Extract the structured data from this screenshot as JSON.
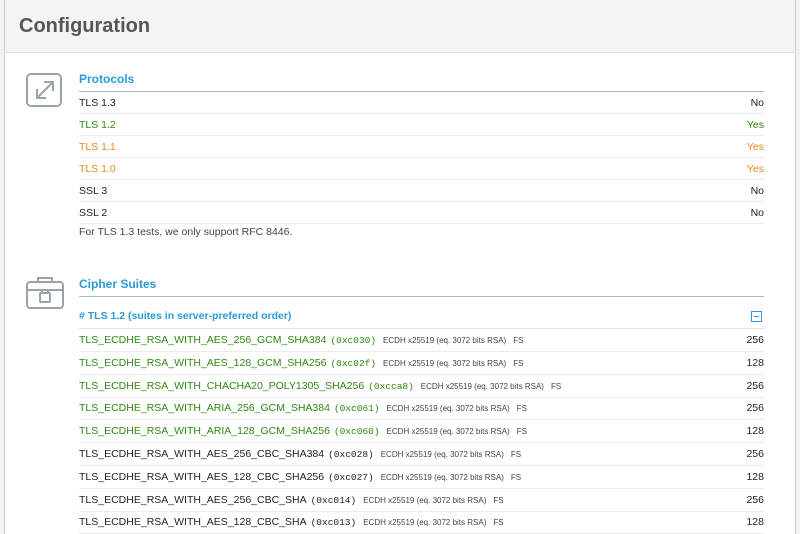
{
  "header": {
    "title": "Configuration"
  },
  "protocols": {
    "title": "Protocols",
    "icon": "resize-arrows-icon",
    "rows": [
      {
        "name": "TLS 1.3",
        "value": "No",
        "status": "neutral"
      },
      {
        "name": "TLS 1.2",
        "value": "Yes",
        "status": "good"
      },
      {
        "name": "TLS 1.1",
        "value": "Yes",
        "status": "warn"
      },
      {
        "name": "TLS 1.0",
        "value": "Yes",
        "status": "warn"
      },
      {
        "name": "SSL 3",
        "value": "No",
        "status": "neutral"
      },
      {
        "name": "SSL 2",
        "value": "No",
        "status": "neutral"
      }
    ],
    "note": "For TLS 1.3 tests, we only support RFC 8446."
  },
  "cipher_suites": {
    "title": "Cipher Suites",
    "icon": "lockbox-icon",
    "group_title": "# TLS 1.2 (suites in server-preferred order)",
    "rows": [
      {
        "name": "TLS_ECDHE_RSA_WITH_AES_256_GCM_SHA384",
        "hex": "(0xc030)",
        "kx": "ECDH x25519 (eq. 3072 bits RSA)",
        "fs": "FS",
        "bits": "256",
        "strong": true
      },
      {
        "name": "TLS_ECDHE_RSA_WITH_AES_128_GCM_SHA256",
        "hex": "(0xc02f)",
        "kx": "ECDH x25519 (eq. 3072 bits RSA)",
        "fs": "FS",
        "bits": "128",
        "strong": true
      },
      {
        "name": "TLS_ECDHE_RSA_WITH_CHACHA20_POLY1305_SHA256",
        "hex": "(0xcca8)",
        "kx": "ECDH x25519 (eq. 3072 bits RSA)",
        "fs": "FS",
        "bits": "256",
        "strong": true
      },
      {
        "name": "TLS_ECDHE_RSA_WITH_ARIA_256_GCM_SHA384",
        "hex": "(0xc061)",
        "kx": "ECDH x25519 (eq. 3072 bits RSA)",
        "fs": "FS",
        "bits": "256",
        "strong": true
      },
      {
        "name": "TLS_ECDHE_RSA_WITH_ARIA_128_GCM_SHA256",
        "hex": "(0xc060)",
        "kx": "ECDH x25519 (eq. 3072 bits RSA)",
        "fs": "FS",
        "bits": "128",
        "strong": true
      },
      {
        "name": "TLS_ECDHE_RSA_WITH_AES_256_CBC_SHA384",
        "hex": "(0xc028)",
        "kx": "ECDH x25519 (eq. 3072 bits RSA)",
        "fs": "FS",
        "bits": "256",
        "strong": false
      },
      {
        "name": "TLS_ECDHE_RSA_WITH_AES_128_CBC_SHA256",
        "hex": "(0xc027)",
        "kx": "ECDH x25519 (eq. 3072 bits RSA)",
        "fs": "FS",
        "bits": "128",
        "strong": false
      },
      {
        "name": "TLS_ECDHE_RSA_WITH_AES_256_CBC_SHA",
        "hex": "(0xc014)",
        "kx": "ECDH x25519 (eq. 3072 bits RSA)",
        "fs": "FS",
        "bits": "256",
        "strong": false
      },
      {
        "name": "TLS_ECDHE_RSA_WITH_AES_128_CBC_SHA",
        "hex": "(0xc013)",
        "kx": "ECDH x25519 (eq. 3072 bits RSA)",
        "fs": "FS",
        "bits": "128",
        "strong": false
      }
    ]
  },
  "colors": {
    "accent": "#2a9bd7",
    "good": "#2d8a12",
    "warn": "#e8891b"
  }
}
